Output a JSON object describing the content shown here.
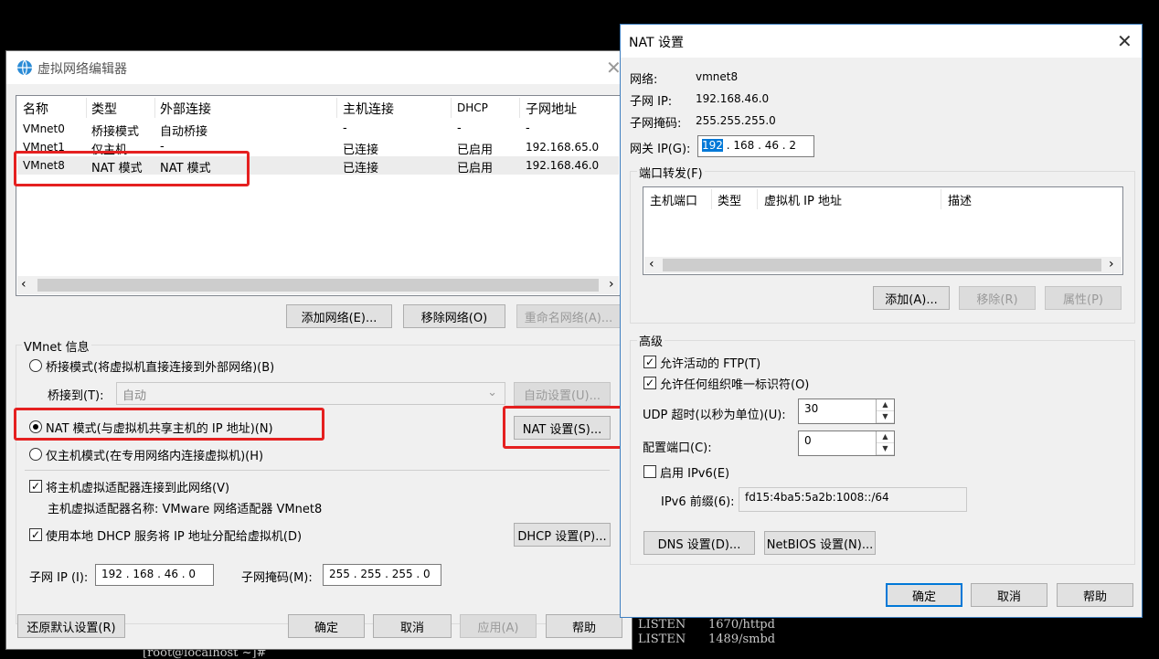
{
  "terminal": {
    "line1": "LISTEN      1670/httpd",
    "line2": "LISTEN      1489/smbd",
    "prompt": "[root@localhost ~]#"
  },
  "editor": {
    "title": "虚拟网络编辑器",
    "columns": [
      "名称",
      "类型",
      "外部连接",
      "主机连接",
      "DHCP",
      "子网地址"
    ],
    "rows": [
      [
        "VMnet0",
        "桥接模式",
        "自动桥接",
        "-",
        "-",
        "-"
      ],
      [
        "VMnet1",
        "仅主机...",
        "-",
        "已连接",
        "已启用",
        "192.168.65.0"
      ],
      [
        "VMnet8",
        "NAT 模式",
        "NAT 模式",
        "已连接",
        "已启用",
        "192.168.46.0"
      ]
    ],
    "add_network": "添加网络(E)...",
    "remove_network": "移除网络(O)",
    "rename_network": "重命名网络(A)...",
    "vmnet_info": "VMnet 信息",
    "bridge_mode": "桥接模式(将虚拟机直接连接到外部网络)(B)",
    "bridge_to_label": "桥接到(T):",
    "bridge_to_value": "自动",
    "auto_settings": "自动设置(U)...",
    "nat_mode": "NAT 模式(与虚拟机共享主机的 IP 地址)(N)",
    "nat_settings": "NAT 设置(S)...",
    "host_only_mode": "仅主机模式(在专用网络内连接虚拟机)(H)",
    "connect_adapter": "将主机虚拟适配器连接到此网络(V)",
    "adapter_name": "主机虚拟适配器名称: VMware 网络适配器 VMnet8",
    "use_dhcp": "使用本地 DHCP 服务将 IP 地址分配给虚拟机(D)",
    "dhcp_settings": "DHCP 设置(P)...",
    "subnet_ip_label": "子网 IP (I):",
    "subnet_ip": "192 . 168 . 46 .  0",
    "subnet_mask_label": "子网掩码(M):",
    "subnet_mask": "255 . 255 . 255 .  0",
    "restore_defaults": "还原默认设置(R)",
    "ok": "确定",
    "cancel": "取消",
    "apply": "应用(A)",
    "help": "帮助"
  },
  "nat": {
    "title": "NAT 设置",
    "network_label": "网络:",
    "network_value": "vmnet8",
    "subnet_ip_label": "子网 IP:",
    "subnet_ip_value": "192.168.46.0",
    "subnet_mask_label": "子网掩码:",
    "subnet_mask_value": "255.255.255.0",
    "gateway_label": "网关 IP(G):",
    "gateway_first": "192",
    "gateway_rest": " . 168 . 46 .  2",
    "port_forwarding": "端口转发(F)",
    "pf_columns": [
      "主机端口",
      "类型",
      "虚拟机 IP 地址",
      "描述"
    ],
    "add": "添加(A)...",
    "remove": "移除(R)",
    "properties": "属性(P)",
    "advanced": "高级",
    "allow_ftp": "允许活动的 FTP(T)",
    "allow_uuid": "允许任何组织唯一标识符(O)",
    "udp_timeout_label": "UDP 超时(以秒为单位)(U):",
    "udp_timeout_value": "30",
    "config_port_label": "配置端口(C):",
    "config_port_value": "0",
    "enable_ipv6": "启用 IPv6(E)",
    "ipv6_prefix_label": "IPv6 前缀(6):",
    "ipv6_prefix_value": "fd15:4ba5:5a2b:1008::/64",
    "dns_settings": "DNS 设置(D)...",
    "netbios_settings": "NetBIOS 设置(N)...",
    "ok": "确定",
    "cancel": "取消",
    "help": "帮助"
  },
  "colors": {
    "highlight": "#e52020",
    "accent": "#0078d7",
    "selection": "#0078d7"
  }
}
